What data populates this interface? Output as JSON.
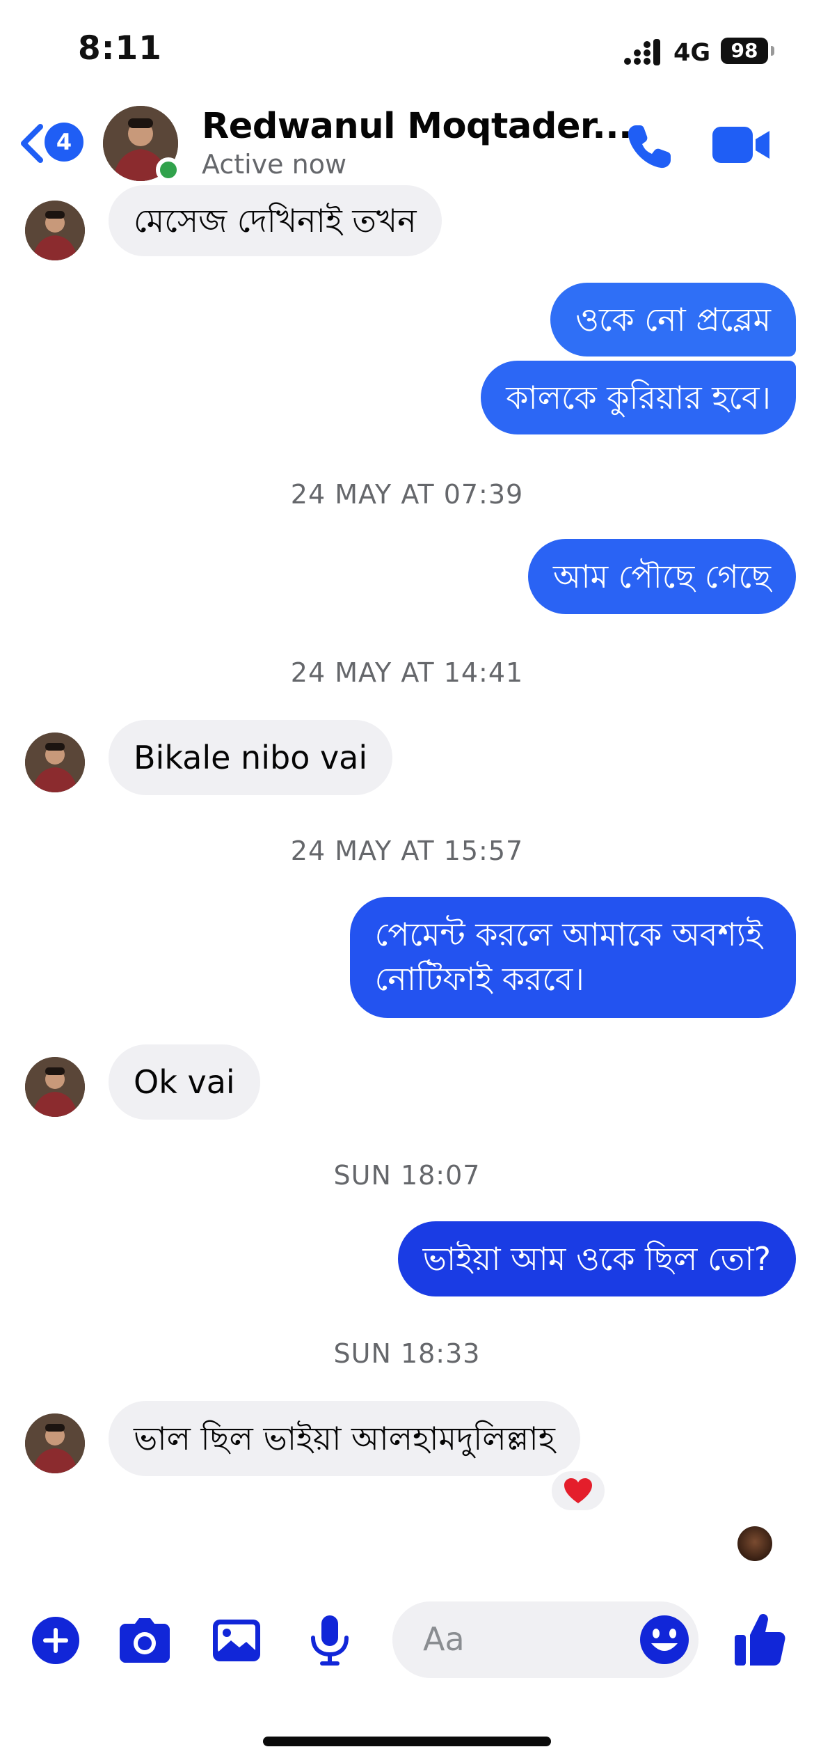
{
  "status_bar": {
    "time": "8:11",
    "network": "4G",
    "battery": "98"
  },
  "header": {
    "back_badge": "4",
    "contact_name": "Redwanul Moqtader...",
    "status": "Active now"
  },
  "messages": [
    {
      "type": "incoming",
      "text": "মেসেজ দেখিনাই তখন"
    },
    {
      "type": "outgoing",
      "text": "ওকে নো প্রব্লেম"
    },
    {
      "type": "outgoing",
      "text": "কালকে কুরিয়ার হবে।"
    },
    {
      "type": "timestamp",
      "text": "24 MAY AT 07:39"
    },
    {
      "type": "outgoing",
      "text": "আম পৌছে গেছে"
    },
    {
      "type": "timestamp",
      "text": "24 MAY AT 14:41"
    },
    {
      "type": "incoming",
      "text": "Bikale nibo vai"
    },
    {
      "type": "timestamp",
      "text": "24 MAY AT 15:57"
    },
    {
      "type": "outgoing",
      "lines": [
        "পেমেন্ট করলে আমাকে অবশ্যই",
        "নোটিফাই করবে।"
      ]
    },
    {
      "type": "incoming",
      "text": "Ok vai"
    },
    {
      "type": "timestamp",
      "text": "SUN 18:07"
    },
    {
      "type": "outgoing",
      "text": "ভাইয়া আম ওকে ছিল তো?"
    },
    {
      "type": "timestamp",
      "text": "SUN 18:33"
    },
    {
      "type": "incoming",
      "text": "ভাল ছিল ভাইয়া আলহামদুলিল্লাহ"
    }
  ],
  "reaction": "❤",
  "composer": {
    "placeholder": "Aa"
  },
  "colors": {
    "accent": "#1f5ef5",
    "bubble_out_top": "#2a6af5",
    "bubble_out_bottom": "#1a35e0",
    "bubble_in": "#f0f0f3",
    "icon_blue": "#1126d8",
    "online": "#31a24c"
  },
  "icons": [
    "back-chevron-icon",
    "phone-icon",
    "video-camera-icon",
    "plus-icon",
    "camera-icon",
    "gallery-icon",
    "microphone-icon",
    "emoji-icon",
    "thumbs-up-icon"
  ]
}
